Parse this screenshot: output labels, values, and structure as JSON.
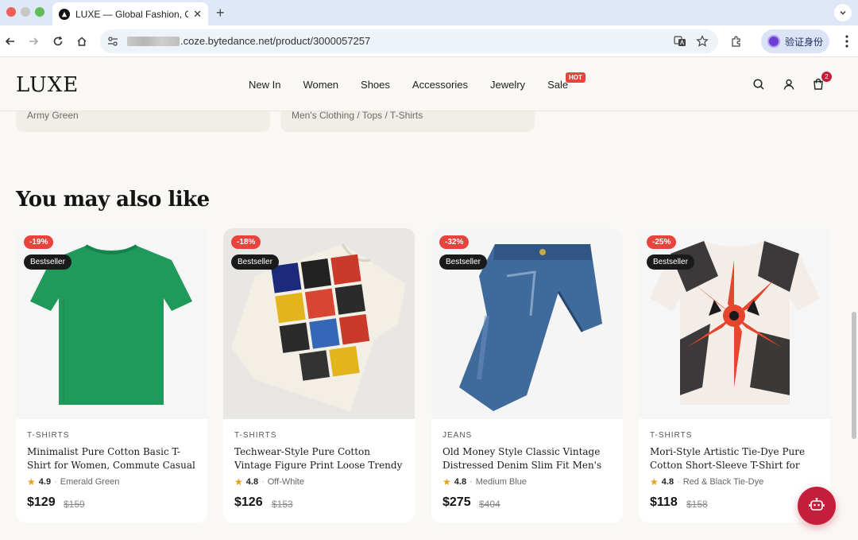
{
  "browser": {
    "tab_title": "LUXE — Global Fashion, Cura",
    "url": "●●●.coze.bytedance.net/product/3000057257",
    "url_visible": ".coze.bytedance.net/product/3000057257",
    "verify_label": "验证身份"
  },
  "site": {
    "logo": "LUXE",
    "nav": [
      "New In",
      "Women",
      "Shoes",
      "Accessories",
      "Jewelry",
      "Sale"
    ],
    "hot_badge": "HOT",
    "cart_count": "2"
  },
  "specs": {
    "color_value": "Army Green",
    "category_value": "Men's Clothing / Tops / T-Shirts"
  },
  "section_title": "You may also like",
  "products": [
    {
      "discount": "-19%",
      "badge": "Bestseller",
      "category": "T-SHIRTS",
      "name": "Minimalist Pure Cotton Basic T-Shirt for Women, Commute Casual Versatile…",
      "rating": "4.9",
      "color": "Emerald Green",
      "price": "$129",
      "old_price": "$159"
    },
    {
      "discount": "-18%",
      "badge": "Bestseller",
      "category": "T-SHIRTS",
      "name": "Techwear-Style Pure Cotton Vintage Figure Print Loose Trendy Men's Short…",
      "rating": "4.8",
      "color": "Off-White",
      "price": "$126",
      "old_price": "$153"
    },
    {
      "discount": "-32%",
      "badge": "Bestseller",
      "category": "JEANS",
      "name": "Old Money Style Classic Vintage Distressed Denim Slim Fit Men's Jeans",
      "rating": "4.8",
      "color": "Medium Blue",
      "price": "$275",
      "old_price": "$404"
    },
    {
      "discount": "-25%",
      "badge": "Bestseller",
      "category": "T-SHIRTS",
      "name": "Mori-Style Artistic Tie-Dye Pure Cotton Short-Sleeve T-Shirt for Men - Loose…",
      "rating": "4.8",
      "color": "Red & Black Tie-Dye",
      "price": "$118",
      "old_price": "$158"
    }
  ],
  "colors": {
    "accent": "#c41e3a",
    "discount": "#e8433c",
    "star": "#e3a11a"
  }
}
